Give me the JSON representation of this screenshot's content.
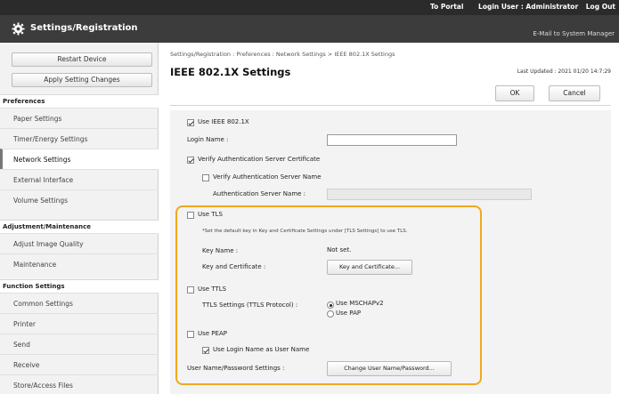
{
  "topbar": {
    "to_portal": "To Portal",
    "login_user": "Login User : Administrator",
    "logout": "Log Out"
  },
  "header": {
    "title": "Settings/Registration",
    "mail": "E-Mail to System Manager"
  },
  "sidebar": {
    "restart": "Restart Device",
    "apply": "Apply Setting Changes",
    "sections": {
      "preferences": "Preferences",
      "adjustment": "Adjustment/Maintenance",
      "function": "Function Settings"
    },
    "items": [
      "Paper Settings",
      "Timer/Energy Settings",
      "Network Settings",
      "External Interface",
      "Volume Settings",
      "Adjust Image Quality",
      "Maintenance",
      "Common Settings",
      "Printer",
      "Send",
      "Receive",
      "Store/Access Files"
    ]
  },
  "main": {
    "breadcrumb": "Settings/Registration : Preferences : Network Settings > IEEE 802.1X Settings",
    "title": "IEEE 802.1X Settings",
    "last_updated": "Last Updated : 2021 01/20 14:7:29",
    "ok": "OK",
    "cancel": "Cancel"
  },
  "form": {
    "use_ieee": "Use IEEE 802.1X",
    "login_name": "Login Name :",
    "verify_cert": "Verify Authentication Server Certificate",
    "verify_name": "Verify Authentication Server Name",
    "auth_server_name": "Authentication Server Name :",
    "use_tls": "Use TLS",
    "tls_note": "*Set the default key in Key and Certificate Settings under [TLS Settings] to use TLS.",
    "key_name_label": "Key Name :",
    "key_name_value": "Not set.",
    "key_cert_label": "Key and Certificate :",
    "key_cert_button": "Key and Certificate...",
    "use_ttls": "Use TTLS",
    "ttls_settings": "TTLS Settings (TTLS Protocol) :",
    "ttls_opt1": "Use MSCHAPv2",
    "ttls_opt2": "Use PAP",
    "use_peap": "Use PEAP",
    "use_login_as_user": "Use Login Name as User Name",
    "user_pw_settings": "User Name/Password Settings :",
    "change_user_pw": "Change User Name/Password..."
  },
  "colors": {
    "highlight": "#f0a81e",
    "header_bg": "#3c3c3c"
  }
}
